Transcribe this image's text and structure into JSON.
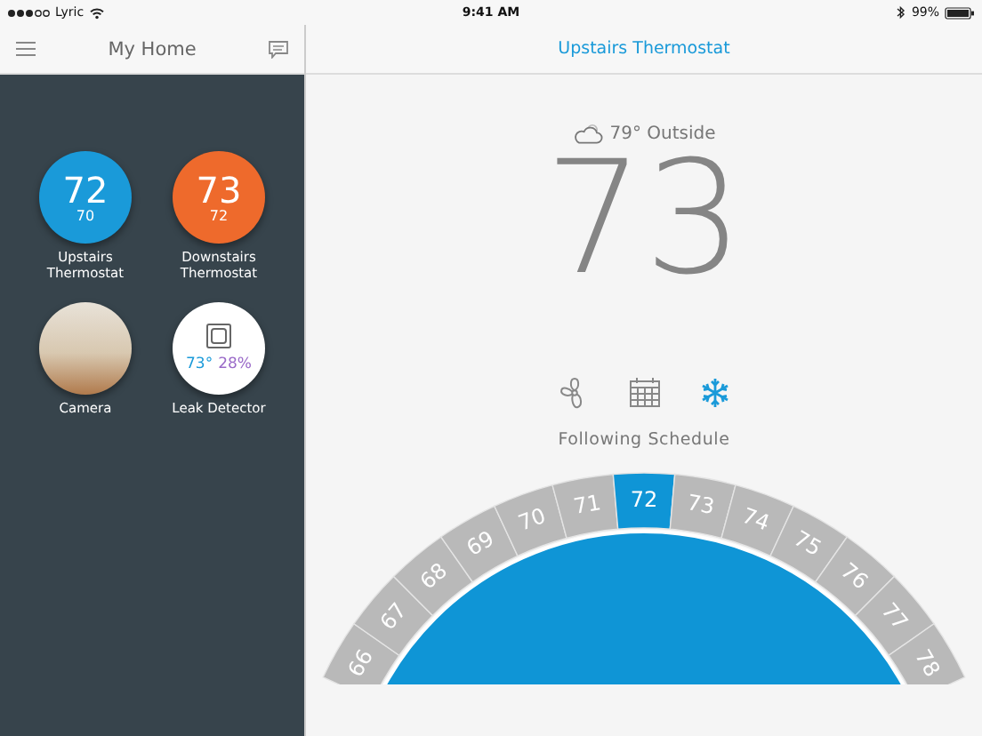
{
  "status_bar": {
    "carrier": "Lyric",
    "time": "9:41 AM",
    "battery": "99%"
  },
  "sidebar": {
    "title": "My Home",
    "device_rows": [
      {
        "devices": [
          {
            "name": "Upstairs Thermostat",
            "kind": "thermostat",
            "temperature": "72",
            "setpoint": "70",
            "color": "#1a9ad9"
          },
          {
            "name": "Downstairs Thermostat",
            "kind": "thermostat",
            "temperature": "73",
            "setpoint": "72",
            "color": "#ee6a2c"
          }
        ]
      },
      {
        "devices": [
          {
            "name": "Camera",
            "kind": "camera"
          },
          {
            "name": "Leak Detector",
            "kind": "leak",
            "temperature": "73°",
            "humidity": "28%"
          }
        ]
      }
    ]
  },
  "main": {
    "title": "Upstairs Thermostat",
    "outside": "79° Outside",
    "temperature": "73",
    "modes": [
      {
        "kind": "fan",
        "selected": false
      },
      {
        "kind": "schedule",
        "selected": false
      },
      {
        "kind": "cool",
        "selected": true
      }
    ],
    "status": "Following Schedule",
    "dial": [
      {
        "label": "66",
        "selected": false
      },
      {
        "label": "67",
        "selected": false
      },
      {
        "label": "68",
        "selected": false
      },
      {
        "label": "69",
        "selected": false
      },
      {
        "label": "70",
        "selected": false
      },
      {
        "label": "71",
        "selected": false
      },
      {
        "label": "72",
        "selected": true
      },
      {
        "label": "73",
        "selected": false
      },
      {
        "label": "74",
        "selected": false
      },
      {
        "label": "75",
        "selected": false
      },
      {
        "label": "76",
        "selected": false
      },
      {
        "label": "77",
        "selected": false
      },
      {
        "label": "78",
        "selected": false
      }
    ]
  }
}
